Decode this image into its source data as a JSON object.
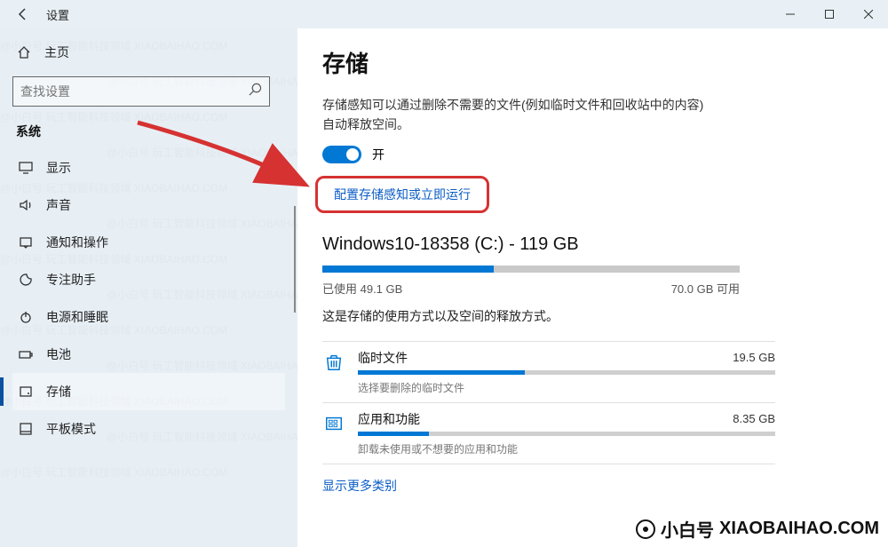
{
  "window": {
    "title": "设置"
  },
  "sidebar": {
    "home": "主页",
    "search_placeholder": "查找设置",
    "section": "系统",
    "items": [
      {
        "icon": "display",
        "label": "显示"
      },
      {
        "icon": "sound",
        "label": "声音"
      },
      {
        "icon": "notify",
        "label": "通知和操作"
      },
      {
        "icon": "focus",
        "label": "专注助手"
      },
      {
        "icon": "power",
        "label": "电源和睡眠"
      },
      {
        "icon": "battery",
        "label": "电池"
      },
      {
        "icon": "storage",
        "label": "存储"
      },
      {
        "icon": "tablet",
        "label": "平板模式"
      }
    ],
    "selected_index": 6
  },
  "main": {
    "title": "存储",
    "desc": "存储感知可以通过删除不需要的文件(例如临时文件和回收站中的内容)自动释放空间。",
    "toggle_state": "开",
    "config_link": "配置存储感知或立即运行",
    "drive": {
      "title": "Windows10-18358 (C:) - 119 GB",
      "used_label": "已使用 49.1 GB",
      "free_label": "70.0 GB 可用",
      "used_pct": 41,
      "note": "这是存储的使用方式以及空间的释放方式。"
    },
    "categories": [
      {
        "name": "临时文件",
        "size": "19.5 GB",
        "pct": 40,
        "sub": "选择要删除的临时文件"
      },
      {
        "name": "应用和功能",
        "size": "8.35 GB",
        "pct": 17,
        "sub": "卸载未使用或不想要的应用和功能"
      }
    ],
    "show_more": "显示更多类别"
  },
  "watermark": {
    "brand": "小白号",
    "domain": "XIAOBAIHAO.COM",
    "light": "@小白号  玩工智能科技领域  XIAOBAIHAO.COM"
  }
}
